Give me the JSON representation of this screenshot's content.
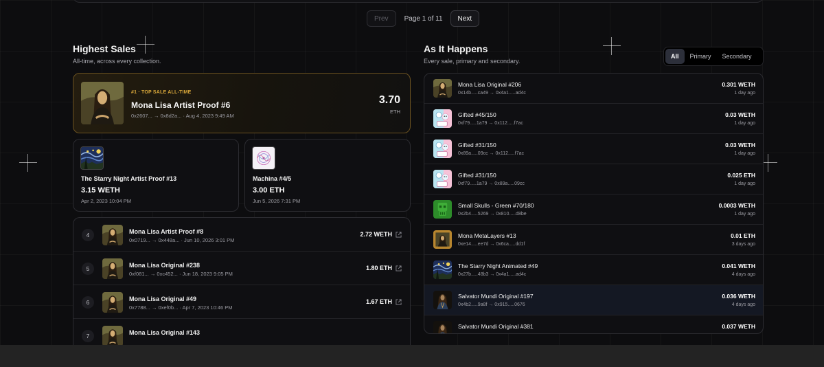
{
  "pagination": {
    "prev_label": "Prev",
    "info": "Page 1 of 11",
    "next_label": "Next"
  },
  "highest_sales": {
    "title": "Highest Sales",
    "subtitle": "All-time, across every collection.",
    "top": {
      "badge": "#1 · TOP SALE ALL-TIME",
      "name": "Mona Lisa Artist Proof #6",
      "meta": "0x2607... → 0x8d2a... · Aug 4, 2023 9:49 AM",
      "price": "3.70",
      "unit": "ETH",
      "art": "mona-lisa"
    },
    "second": {
      "name": "The Starry Night Artist Proof #13",
      "price": "3.15 WETH",
      "date": "Apr 2, 2023 10:04 PM",
      "art": "starry-night"
    },
    "third": {
      "name": "Machina #4/5",
      "price": "3.00 ETH",
      "date": "Jun 5, 2026 7:31 PM",
      "art": "machina"
    },
    "ranked": [
      {
        "rank": "4",
        "name": "Mona Lisa Artist Proof #8",
        "meta": "0x0719... → 0x448a... · Jun 10, 2026 3:01 PM",
        "price": "2.72 WETH",
        "art": "mona-lisa"
      },
      {
        "rank": "5",
        "name": "Mona Lisa Original #238",
        "meta": "0xf081... → 0xc452... · Jun 18, 2023 9:05 PM",
        "price": "1.80 ETH",
        "art": "mona-lisa"
      },
      {
        "rank": "6",
        "name": "Mona Lisa Original #49",
        "meta": "0x7788... → 0xef0b... · Apr 7, 2023 10:46 PM",
        "price": "1.67 ETH",
        "art": "mona-lisa"
      },
      {
        "rank": "7",
        "name": "Mona Lisa Original #143",
        "meta": "",
        "price": "",
        "art": "mona-lisa"
      }
    ]
  },
  "feed": {
    "title": "As It Happens",
    "subtitle": "Every sale, primary and secondary.",
    "tabs": [
      {
        "label": "All",
        "active": true
      },
      {
        "label": "Primary",
        "active": false
      },
      {
        "label": "Secondary",
        "active": false
      }
    ],
    "rows": [
      {
        "name": "Mona Lisa Original #206",
        "addr": "0x14b.....ca49 → 0x4a1.....ad4c",
        "price": "0.301 WETH",
        "time": "1 day ago",
        "art": "mona-lisa",
        "highlight": false
      },
      {
        "name": "Gifted #45/150",
        "addr": "0xf79.....1a79 → 0x112.....f7ac",
        "price": "0.03 WETH",
        "time": "1 day ago",
        "art": "gifted",
        "highlight": false
      },
      {
        "name": "Gifted #31/150",
        "addr": "0x89a.....09cc → 0x112.....f7ac",
        "price": "0.03 WETH",
        "time": "1 day ago",
        "art": "gifted",
        "highlight": false
      },
      {
        "name": "Gifted #31/150",
        "addr": "0xf79.....1a79 → 0x89a.....09cc",
        "price": "0.025 ETH",
        "time": "1 day ago",
        "art": "gifted",
        "highlight": false
      },
      {
        "name": "Small Skulls - Green #70/180",
        "addr": "0x2b4.....5269 → 0x810.....d8be",
        "price": "0.0003 WETH",
        "time": "1 day ago",
        "art": "skull-green",
        "highlight": false
      },
      {
        "name": "Mona MetaLayers #13",
        "addr": "0xe14.....ee7d → 0x6ca.....dd1f",
        "price": "0.01 ETH",
        "time": "3 days ago",
        "art": "mona-framed",
        "highlight": false
      },
      {
        "name": "The Starry Night Animated #49",
        "addr": "0x27b.....48b3 → 0x4a1.....ad4c",
        "price": "0.041 WETH",
        "time": "4 days ago",
        "art": "starry-night",
        "highlight": false
      },
      {
        "name": "Salvator Mundi Original #197",
        "addr": "0x4b2.....9a8f → 0x915.....0676",
        "price": "0.036 WETH",
        "time": "4 days ago",
        "art": "salvator",
        "highlight": true
      },
      {
        "name": "Salvator Mundi Original #381",
        "addr": "",
        "price": "0.037 WETH",
        "time": "",
        "art": "salvator",
        "highlight": false
      }
    ]
  },
  "colors": {
    "accent_gold": "#d9a83a",
    "tab_active_bg": "#2c2f3a",
    "page_bg": "#0d0d0f"
  }
}
